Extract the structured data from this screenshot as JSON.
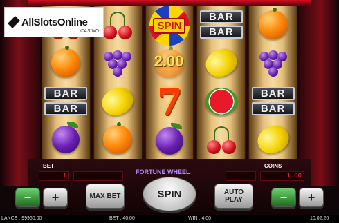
{
  "logo": {
    "name": "AllSlotsOnline",
    "suffix": ".CASINO"
  },
  "reels": [
    [
      "cherries",
      "orange",
      "bar",
      "plum"
    ],
    [
      "cherries",
      "grapes",
      "lemon",
      "orange"
    ],
    [
      "spin",
      "orange",
      "seven",
      "plum"
    ],
    [
      "bar",
      "lemon",
      "watermelon",
      "cherries"
    ],
    [
      "orange",
      "grapes",
      "bar",
      "lemon"
    ]
  ],
  "symbols": {
    "bar_text": "BAR",
    "spin_text": "SPIN",
    "seven_text": "7"
  },
  "win_overlay": "2.00",
  "panel": {
    "bet_label": "BET",
    "bet_value": "1",
    "coins_label": "COINS",
    "coins_value": "1.00",
    "game_title": "FORTUNE WHEEL"
  },
  "buttons": {
    "minus": "−",
    "plus": "+",
    "max_bet": "MAX BET",
    "spin": "SPIN",
    "auto_play": "AUTO PLAY",
    "coins_minus": "−",
    "coins_plus": "+"
  },
  "status_bar": {
    "balance": "LANCE : 99960.00",
    "bet": "BET : 40.00",
    "win": "WIN : 4.00",
    "time": "10.02.20"
  },
  "colors": {
    "accent_red": "#d01020",
    "win_yellow": "#ffe066"
  }
}
